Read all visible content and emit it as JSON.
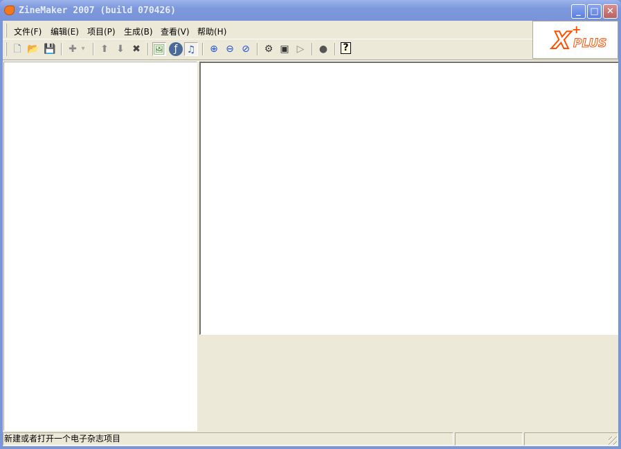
{
  "window": {
    "title": "ZineMaker 2007 (build 070426)",
    "min": "_",
    "max": "□",
    "close": "✕"
  },
  "menu": [
    "文件(F)",
    "编辑(E)",
    "项目(P)",
    "生成(B)",
    "查看(V)",
    "帮助(H)"
  ],
  "toolbar": {
    "new": "🗋",
    "open": "📂",
    "save": "💾",
    "add": "✚",
    "dropdown": "▾",
    "up": "⬆",
    "down": "⬇",
    "delete": "✖",
    "image": "🖼",
    "flash": "ƒ",
    "music": "♫",
    "zoom_in": "⊕",
    "zoom_out": "⊖",
    "zoom_reset": "⊘",
    "settings": "⚙",
    "build": "▣",
    "play": "▷",
    "web": "●",
    "help": "?"
  },
  "logo": {
    "x": "X",
    "plus": "PLUS",
    "cross": "+"
  },
  "status": {
    "message": "新建或者打开一个电子杂志项目",
    "pane2": "",
    "pane3": ""
  }
}
